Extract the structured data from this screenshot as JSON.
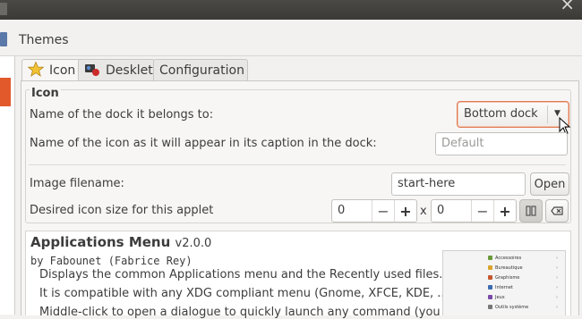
{
  "window": {
    "close_glyph": "×"
  },
  "header": {
    "title": "Themes",
    "icon": "themes-icon"
  },
  "tabs": [
    {
      "label": "Icon",
      "icon": "star-icon"
    },
    {
      "label": "Desklet",
      "icon": "desklet-icon"
    },
    {
      "label": "Configuration"
    }
  ],
  "icon_group": {
    "title": "Icon",
    "dock_label": "Name of the dock it belongs to:",
    "dock_value": "Bottom dock",
    "caption_label": "Name of the icon as it will appear in its caption in the dock:",
    "caption_placeholder": "Default",
    "image_label": "Image filename:",
    "image_value": "start-here",
    "open_label": "Open",
    "size_label": "Desired icon size for this applet",
    "width_value": "0",
    "height_value": "0",
    "x_sep": "x",
    "minus": "−",
    "plus": "+"
  },
  "applet": {
    "name": "Applications Menu",
    "version": "v2.0.0",
    "author": "by Fabounet (Fabrice Rey)",
    "desc": [
      "Displays the common Applications menu and the Recently used files.",
      "It is compatible with any XDG compliant menu (Gnome, XFCE, KDE, ...)",
      "Middle-click to open a dialogue to quickly launch any command (you can"
    ],
    "preview_items": [
      {
        "label": "Accessoires",
        "color": "#6a9a3a"
      },
      {
        "label": "Bureautique",
        "color": "#d9a32b"
      },
      {
        "label": "Graphisme",
        "color": "#c4572d"
      },
      {
        "label": "Internet",
        "color": "#3a6ab0"
      },
      {
        "label": "Jeux",
        "color": "#7a4aa8"
      },
      {
        "label": "Outils système",
        "color": "#777777"
      }
    ]
  },
  "colors": {
    "accent": "#e25a2c",
    "focus_border": "#e07a52"
  }
}
